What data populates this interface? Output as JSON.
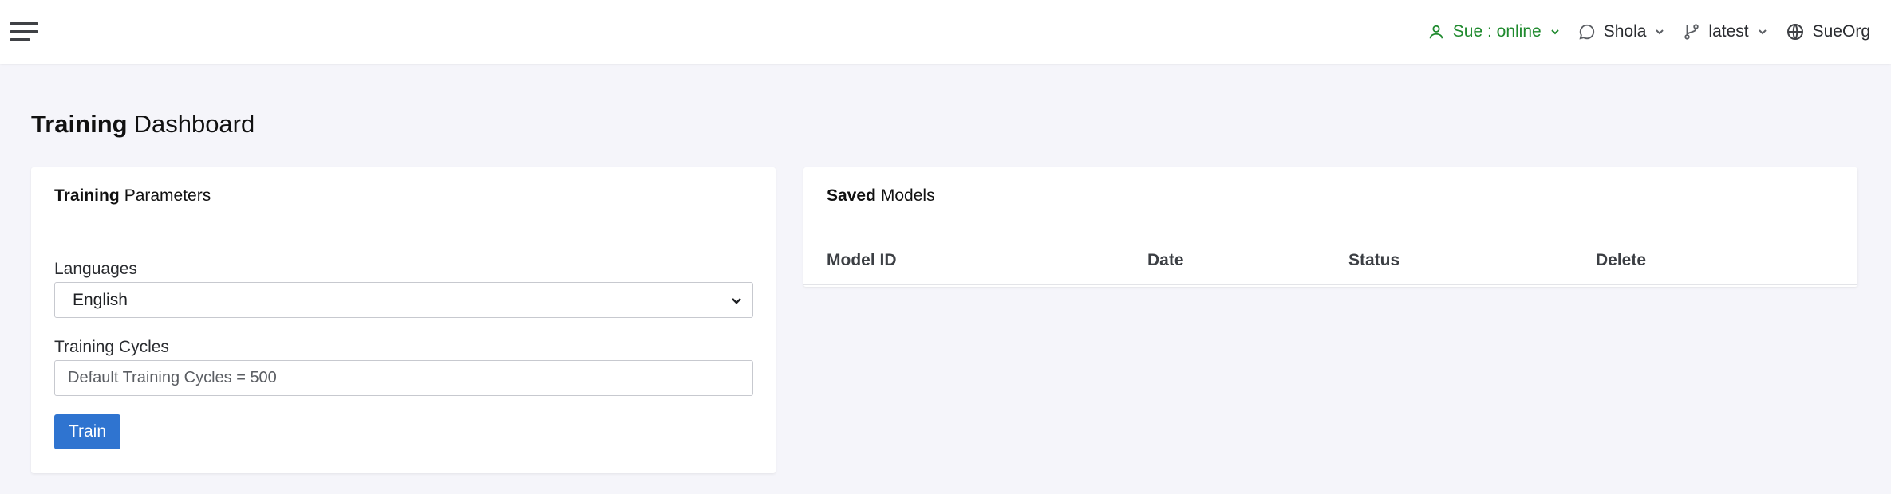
{
  "topbar": {
    "user_label": "Sue : online",
    "agent_label": "Shola",
    "version_label": "latest",
    "org_label": "SueOrg"
  },
  "page": {
    "title_bold": "Training",
    "title_rest": "Dashboard"
  },
  "training_parameters": {
    "title_bold": "Training",
    "title_rest": "Parameters",
    "languages_label": "Languages",
    "languages_selected": "English",
    "cycles_label": "Training Cycles",
    "cycles_placeholder": "Default Training Cycles = 500",
    "cycles_value": "",
    "train_button": "Train"
  },
  "saved_models": {
    "title_bold": "Saved",
    "title_rest": "Models",
    "columns": [
      "Model ID",
      "Date",
      "Status",
      "Delete"
    ],
    "rows": []
  },
  "colors": {
    "online_green": "#1f8a2e",
    "primary_blue": "#2f74d0",
    "page_bg": "#f5f5fa"
  },
  "icons": [
    "hamburger-menu-icon",
    "user-icon",
    "chat-bubble-icon",
    "git-branch-icon",
    "globe-icon",
    "chevron-down-icon"
  ]
}
